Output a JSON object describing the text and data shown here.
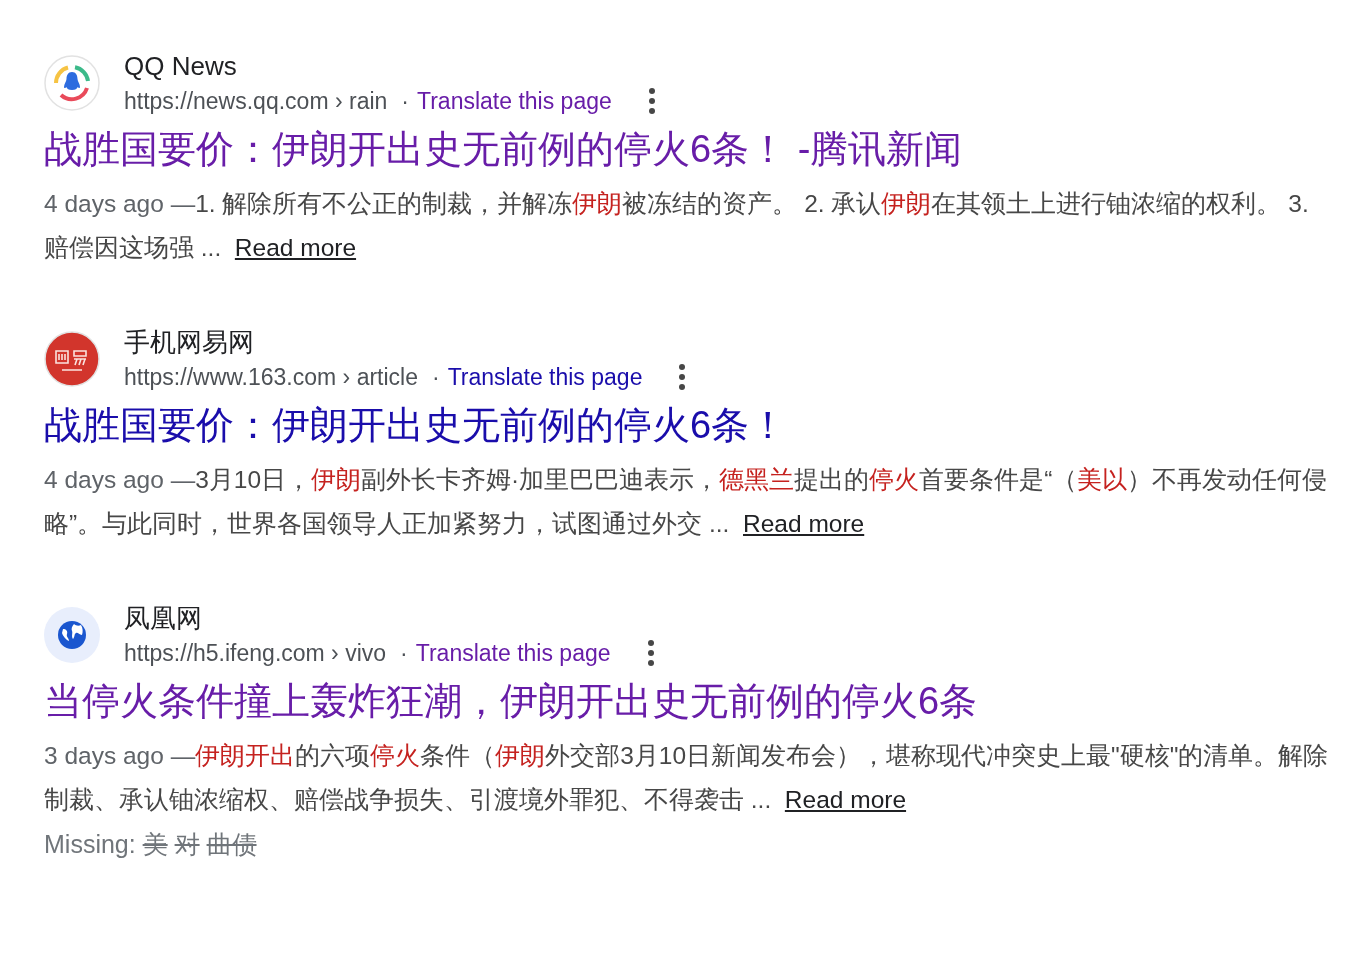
{
  "results": [
    {
      "kind": "qq",
      "site": "QQ News",
      "url": "https://news.qq.com › rain",
      "separator": "·",
      "translate": "Translate this page",
      "visited": true,
      "title": "战胜国要价：伊朗开出史无前例的停火6条！ -腾讯新闻",
      "date": "4 days ago —",
      "snippet": [
        {
          "text": "1. 解除所有不公正的制裁，并解冻",
          "highlight": false
        },
        {
          "text": "伊朗",
          "highlight": true
        },
        {
          "text": "被冻结的资产。 2. 承认",
          "highlight": false
        },
        {
          "text": "伊朗",
          "highlight": true
        },
        {
          "text": "在其领土上进行铀浓缩的权利。 3. 赔偿因这场强 ...",
          "highlight": false
        }
      ],
      "read_more": "Read more"
    },
    {
      "kind": "netease",
      "site": "手机网易网",
      "url": "https://www.163.com › article",
      "separator": "·",
      "translate": "Translate this page",
      "visited": false,
      "title": "战胜国要价：伊朗开出史无前例的停火6条！",
      "date": "4 days ago —",
      "snippet": [
        {
          "text": "3月10日，",
          "highlight": false
        },
        {
          "text": "伊朗",
          "highlight": true
        },
        {
          "text": "副外长卡齐姆·加里巴巴迪表示，",
          "highlight": false
        },
        {
          "text": "德黑兰",
          "highlight": true
        },
        {
          "text": "提出的",
          "highlight": false
        },
        {
          "text": "停火",
          "highlight": true
        },
        {
          "text": "首要条件是“（",
          "highlight": false
        },
        {
          "text": "美以",
          "highlight": true
        },
        {
          "text": "）不再发动任何侵略”。与此同时，世界各国领导人正加紧努力，试图通过外交 ...",
          "highlight": false
        }
      ],
      "read_more": "Read more"
    },
    {
      "kind": "globe",
      "site": "凤凰网",
      "url": "https://h5.ifeng.com › vivo",
      "separator": "·",
      "translate": "Translate this page",
      "visited": true,
      "title": "当停火条件撞上轰炸狂潮，伊朗开出史无前例的停火6条",
      "date": "3 days ago —",
      "snippet": [
        {
          "text": "伊朗开出",
          "highlight": true
        },
        {
          "text": "的六项",
          "highlight": false
        },
        {
          "text": "停火",
          "highlight": true
        },
        {
          "text": "条件（",
          "highlight": false
        },
        {
          "text": "伊朗",
          "highlight": true
        },
        {
          "text": "外交部3月10日新闻发布会），堪称现代冲突史上最\"硬核\"的清单。解除制裁、承认铀浓缩权、赔偿战争损失、引渡境外罪犯、不得袭击 ...",
          "highlight": false
        }
      ],
      "read_more": "Read more",
      "missing": {
        "label": "Missing:",
        "terms": [
          "美",
          "对",
          "曲债"
        ]
      }
    }
  ]
}
